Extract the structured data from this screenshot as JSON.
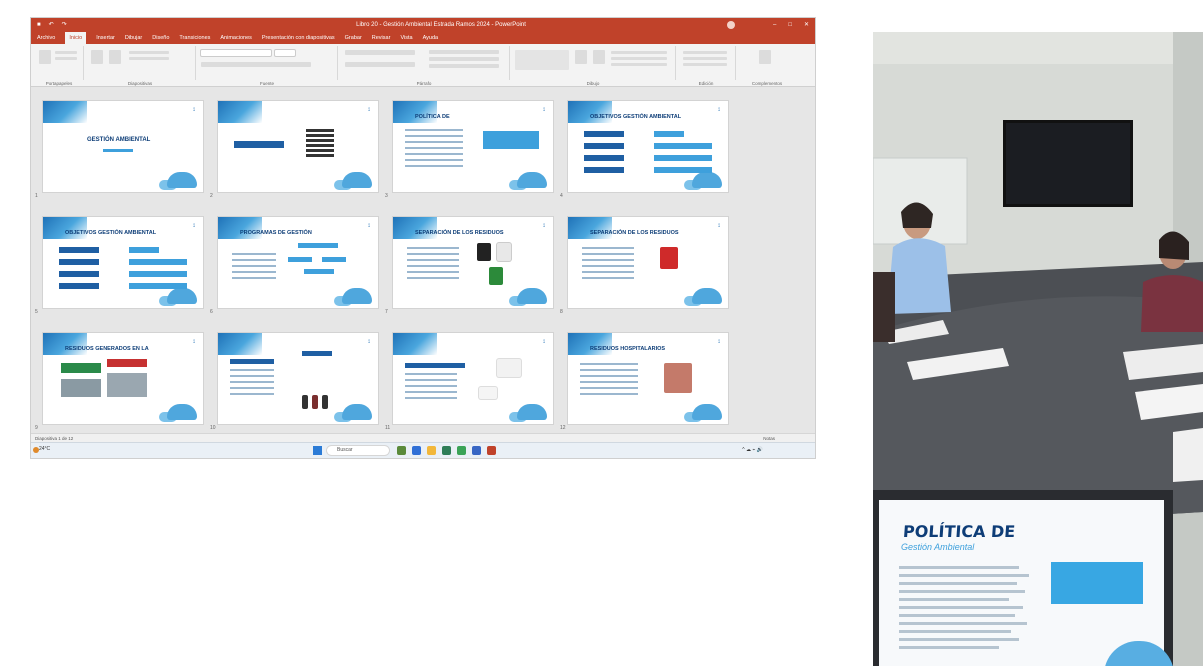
{
  "screenshot": {
    "window_title": "Libro 20 - Gestión Ambiental Estrada Ramos 2024 - PowerPoint",
    "account": "",
    "ribbon_tabs": [
      "Archivo",
      "Inicio",
      "Insertar",
      "Dibujar",
      "Diseño",
      "Transiciones",
      "Animaciones",
      "Presentación con diapositivas",
      "Grabar",
      "Revisar",
      "Vista",
      "Ayuda"
    ],
    "active_tab": "Inicio",
    "ribbon_groups": [
      "Portapapeles",
      "Diapositivas",
      "Fuente",
      "Párrafo",
      "Dibujo",
      "Edición",
      "Complementos"
    ],
    "slides": [
      {
        "num": "1",
        "title": "GESTIÓN AMBIENTAL"
      },
      {
        "num": "2",
        "title": ""
      },
      {
        "num": "3",
        "title": "POLÍTICA DE"
      },
      {
        "num": "4",
        "title": "OBJETIVOS GESTIÓN AMBIENTAL"
      },
      {
        "num": "5",
        "title": "OBJETIVOS GESTIÓN AMBIENTAL"
      },
      {
        "num": "6",
        "title": "PROGRAMAS DE GESTIÓN"
      },
      {
        "num": "7",
        "title": "SEPARACIÓN DE LOS RESIDUOS"
      },
      {
        "num": "8",
        "title": "SEPARACIÓN DE LOS RESIDUOS"
      },
      {
        "num": "9",
        "title": "RESIDUOS GENERADOS EN LA"
      },
      {
        "num": "10",
        "title": ""
      },
      {
        "num": "11",
        "title": ""
      },
      {
        "num": "12",
        "title": "RESIDUOS HOSPITALARIOS"
      }
    ],
    "status_left": "Diapositiva 1 de 12",
    "status_right": "Notas",
    "zoom": "",
    "weather": "24°C",
    "taskbar_search": "Buscar",
    "clock_time": "",
    "clock_date": "",
    "colors": {
      "titlebar": "#c0422a",
      "slide_blue": "#1f5fa3",
      "slide_light_blue": "#3ea0dc"
    }
  },
  "photo": {
    "laptop_slide": {
      "title": "POLÍTICA DE",
      "subtitle": "Gestión Ambiental",
      "logo": ""
    }
  }
}
